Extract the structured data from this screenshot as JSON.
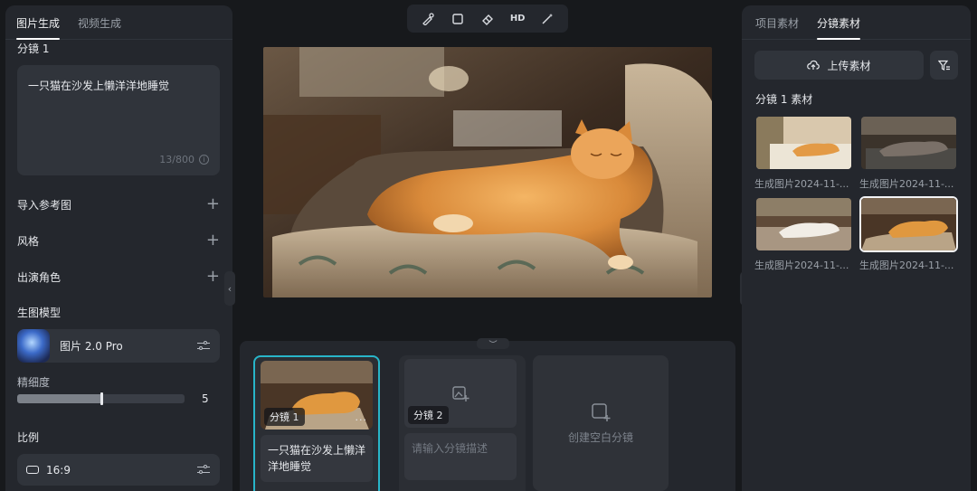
{
  "left_panel": {
    "tabs": [
      {
        "label": "图片生成",
        "active": true
      },
      {
        "label": "视频生成",
        "active": false
      }
    ],
    "shot_title": "分镜 1",
    "prompt_text": "一只猫在沙发上懒洋洋地睡觉",
    "prompt_counter": "13/800",
    "info_icon": "i",
    "sections": {
      "ref_image": "导入参考图",
      "style": "风格",
      "cast": "出演角色",
      "model": "生图模型",
      "plus": "+"
    },
    "model_name": "图片 2.0 Pro",
    "detail_label": "精细度",
    "detail_value": "5",
    "detail_fraction": 0.5,
    "ratio_label": "比例",
    "ratio_value": "16:9"
  },
  "toolbar": {
    "items": [
      {
        "icon": "brush-icon"
      },
      {
        "icon": "crop-icon"
      },
      {
        "icon": "eraser-icon"
      },
      {
        "label": "HD"
      },
      {
        "icon": "magic-wand-icon"
      }
    ]
  },
  "storyboard": {
    "shots": [
      {
        "label": "分镜 1",
        "more": "···",
        "description": "一只猫在沙发上懒洋洋地睡觉",
        "selected": true
      },
      {
        "label": "分镜 2",
        "placeholder": "请输入分镜描述"
      }
    ],
    "create_blank": "创建空白分镜"
  },
  "right_panel": {
    "tabs": [
      {
        "label": "项目素材",
        "active": false
      },
      {
        "label": "分镜素材",
        "active": true
      }
    ],
    "upload_label": "上传素材",
    "assets_title": "分镜 1 素材",
    "assets": [
      {
        "caption": "生成图片2024-11-...",
        "selected": false
      },
      {
        "caption": "生成图片2024-11-...",
        "selected": false
      },
      {
        "caption": "生成图片2024-11-...",
        "selected": false
      },
      {
        "caption": "生成图片2024-11-...",
        "selected": true
      }
    ]
  },
  "colors": {
    "accent": "#28b5c9",
    "panel": "#24272d",
    "background": "#17191c"
  }
}
